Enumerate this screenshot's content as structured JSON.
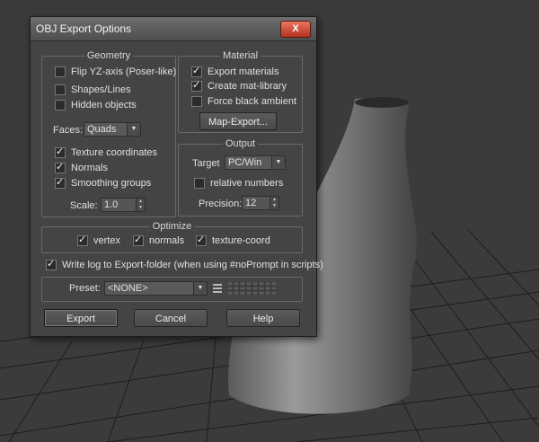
{
  "dialog": {
    "title": "OBJ Export Options",
    "close_label": "X"
  },
  "geometry": {
    "title": "Geometry",
    "flip_yz": {
      "label": "Flip YZ-axis (Poser-like)",
      "checked": false
    },
    "shapes_lines": {
      "label": "Shapes/Lines",
      "checked": false
    },
    "hidden_objects": {
      "label": "Hidden objects",
      "checked": false
    },
    "faces_label": "Faces:",
    "faces_value": "Quads",
    "texture_coordinates": {
      "label": "Texture coordinates",
      "checked": true
    },
    "normals": {
      "label": "Normals",
      "checked": true
    },
    "smoothing_groups": {
      "label": "Smoothing groups",
      "checked": true
    },
    "scale_label": "Scale:",
    "scale_value": "1.0"
  },
  "material": {
    "title": "Material",
    "export_materials": {
      "label": "Export materials",
      "checked": true
    },
    "create_mat_library": {
      "label": "Create mat-library",
      "checked": true
    },
    "force_black_ambient": {
      "label": "Force black ambient",
      "checked": false
    },
    "map_export_label": "Map-Export..."
  },
  "output": {
    "title": "Output",
    "target_label": "Target",
    "target_value": "PC/Win",
    "relative_numbers": {
      "label": "relative numbers",
      "checked": false
    },
    "precision_label": "Precision:",
    "precision_value": "12"
  },
  "optimize": {
    "title": "Optimize",
    "vertex": {
      "label": "vertex",
      "checked": true
    },
    "normals": {
      "label": "normals",
      "checked": true
    },
    "texture_coord": {
      "label": "texture-coord",
      "checked": true
    }
  },
  "write_log": {
    "label": "Write log to Export-folder (when using #noPrompt in scripts)",
    "checked": true
  },
  "preset": {
    "label": "Preset:",
    "value": "<NONE>"
  },
  "buttons": {
    "export": "Export",
    "cancel": "Cancel",
    "help": "Help"
  },
  "colors": {
    "dialog_bg": "#444444",
    "close_button": "#c9452d",
    "viewport_bg": "#3a3a3a"
  }
}
